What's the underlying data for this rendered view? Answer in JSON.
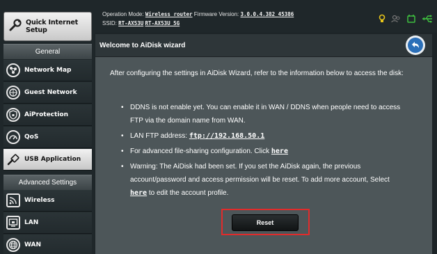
{
  "topbar": {
    "operation_mode_label": "Operation Mode:",
    "operation_mode_value": "Wireless router",
    "firmware_label": "Firmware Version:",
    "firmware_value": "3.0.0.4.382_45386",
    "ssid_label": "SSID:",
    "ssid_1": "RT-AX53U",
    "ssid_2": "RT-AX53U_5G"
  },
  "sidebar": {
    "qis_label": "Quick Internet Setup",
    "general_header": "General",
    "general_items": [
      {
        "label": "Network Map",
        "icon": "network-map-icon"
      },
      {
        "label": "Guest Network",
        "icon": "guest-network-icon"
      },
      {
        "label": "AiProtection",
        "icon": "aiprotection-icon"
      },
      {
        "label": "QoS",
        "icon": "qos-icon"
      },
      {
        "label": "USB Application",
        "icon": "usb-application-icon",
        "active": true
      }
    ],
    "advanced_header": "Advanced Settings",
    "advanced_items": [
      {
        "label": "Wireless",
        "icon": "wireless-icon"
      },
      {
        "label": "LAN",
        "icon": "lan-icon"
      },
      {
        "label": "WAN",
        "icon": "wan-icon"
      }
    ]
  },
  "panel": {
    "title": "Welcome to AiDisk wizard",
    "intro": "After configuring the settings in AiDisk Wizard, refer to the information below to access the disk:",
    "ddns_text": "DDNS is not enable yet. You can enable it in WAN / DDNS when people need to access FTP via the domain name from WAN.",
    "ftp_label": "LAN FTP address:",
    "ftp_value": "ftp://192.168.50.1",
    "advanced_text": "For advanced file-sharing configuration. Click",
    "here_link": "here",
    "warning_text": "Warning: The AiDisk had been set. If you set the AiDisk again, the previous account/password and access permission will be reset. To add more account, Select",
    "warning_tail": "to edit the account profile.",
    "reset_label": "Reset"
  },
  "colors": {
    "background": "#1d2427",
    "panel": "#4d5659",
    "highlight_border": "#e12b2b",
    "status_yellow": "#e8c51a",
    "status_green": "#3fbf3f"
  }
}
